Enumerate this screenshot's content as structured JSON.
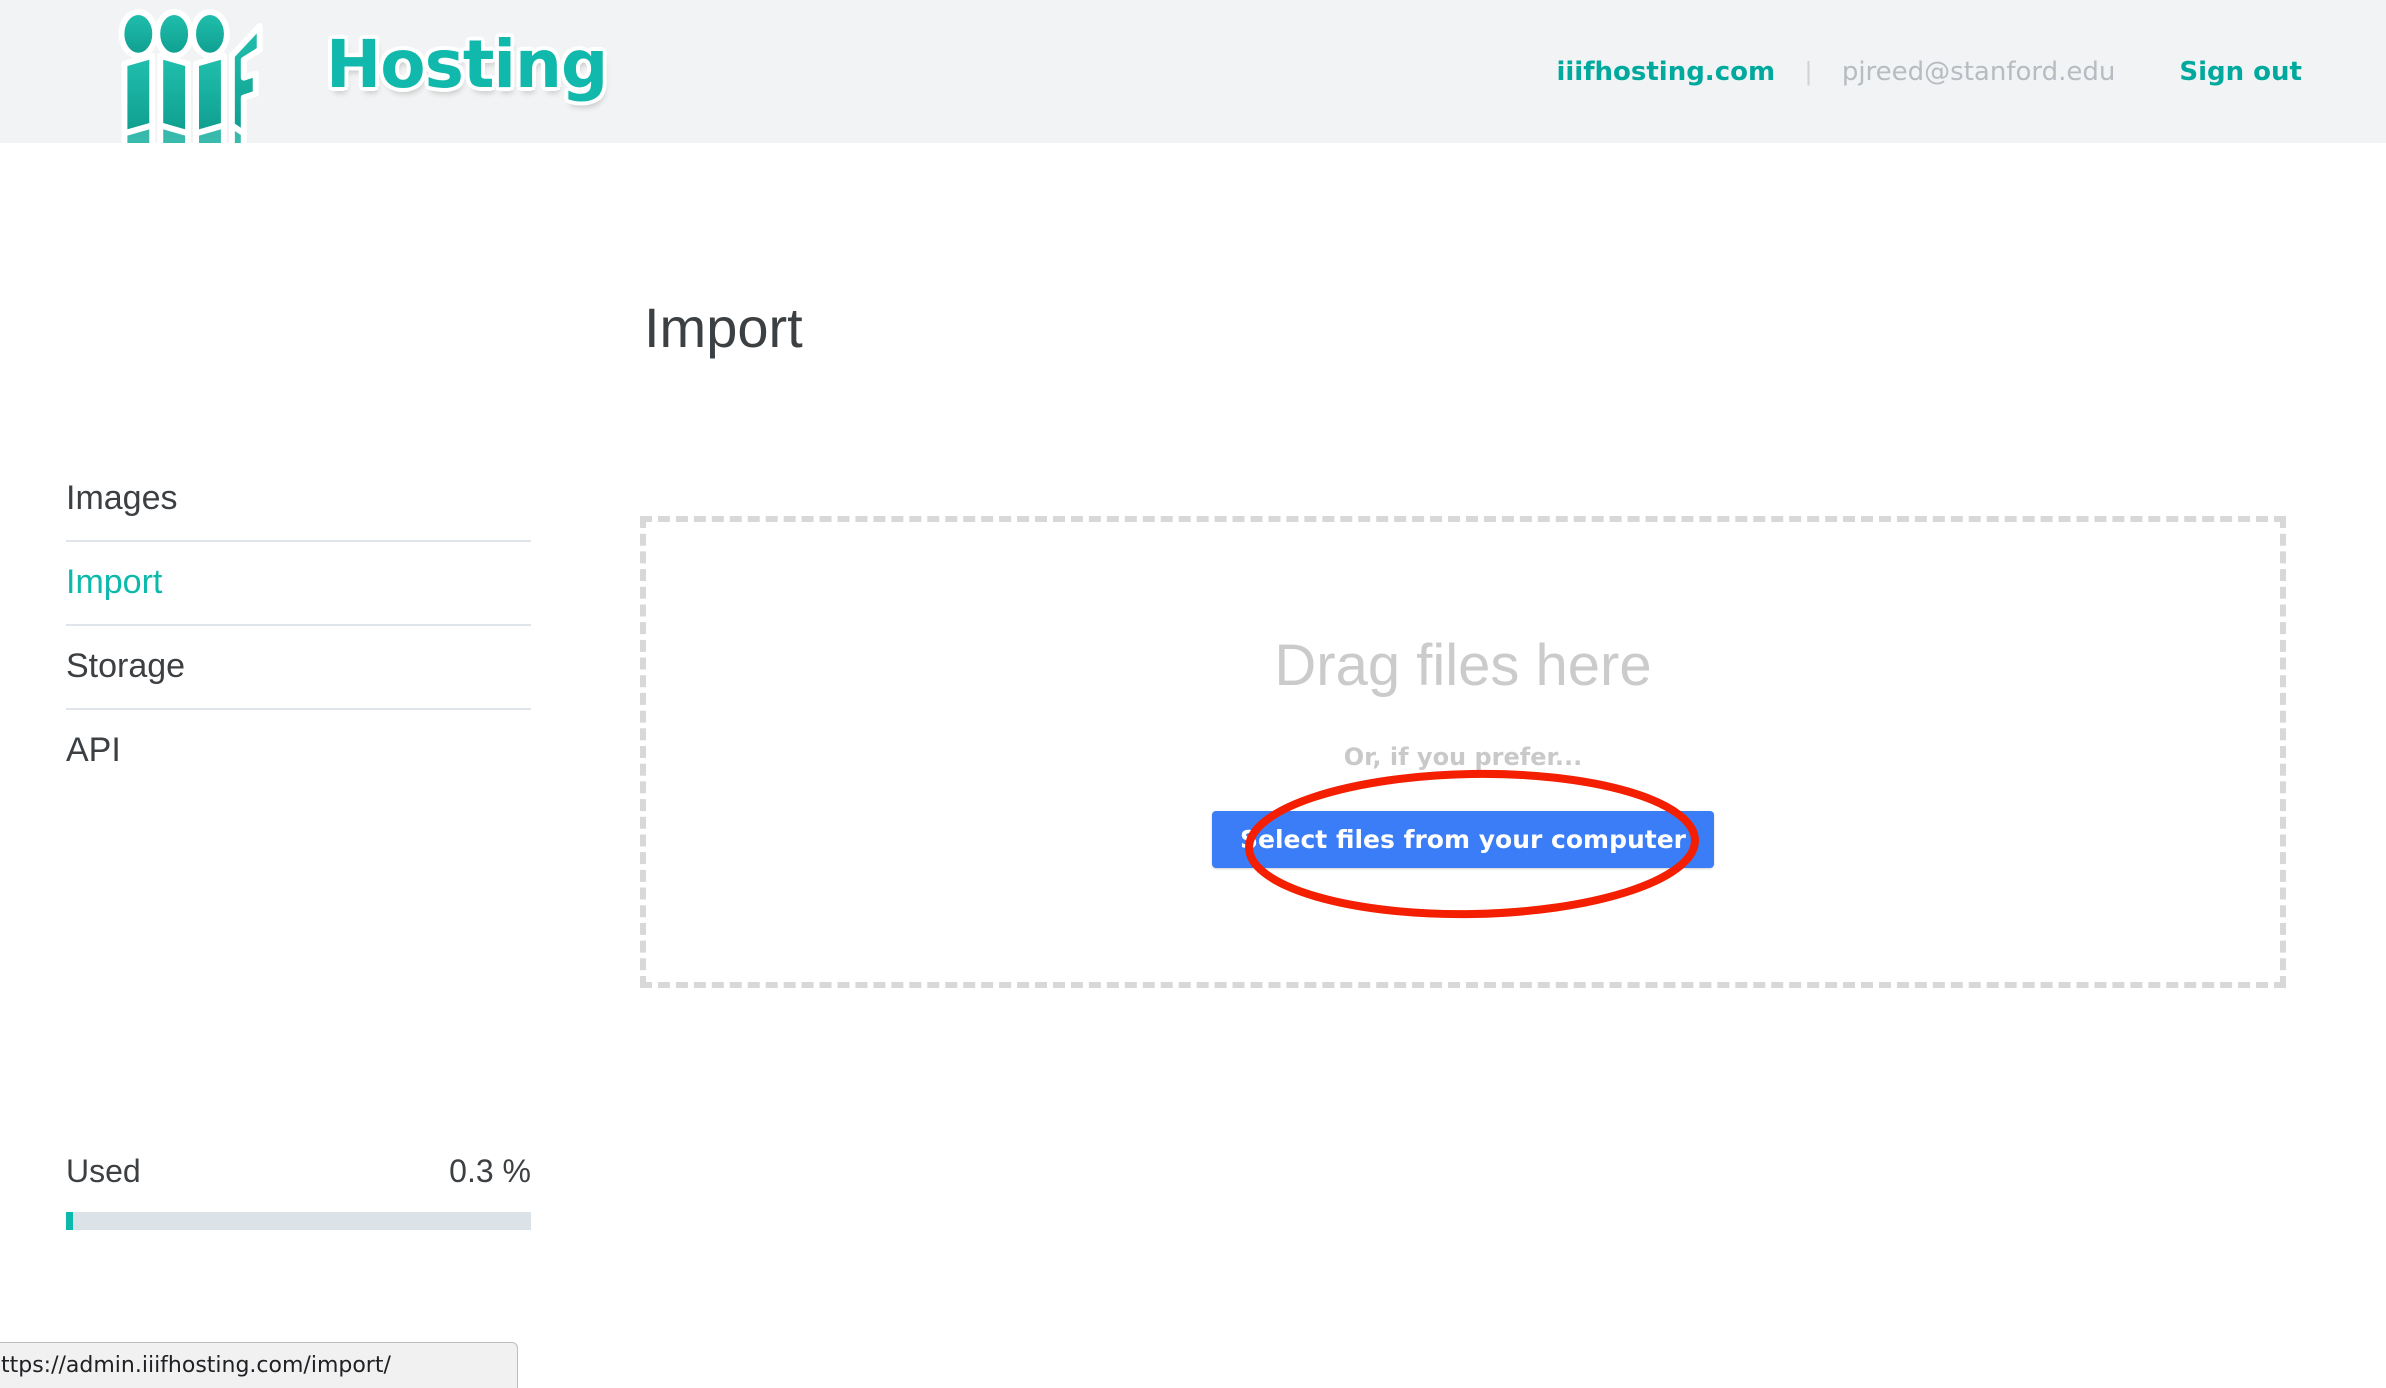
{
  "brand": {
    "logo_icon": "iiif-logo-icon",
    "word": "Hosting",
    "accent_color": "#10b9ab"
  },
  "header": {
    "site_link": "iiifhosting.com",
    "separator": "|",
    "user_email": "pjreed@stanford.edu",
    "sign_out": "Sign out"
  },
  "sidebar": {
    "items": [
      {
        "label": "Images",
        "active": false
      },
      {
        "label": "Import",
        "active": true
      },
      {
        "label": "Storage",
        "active": false
      },
      {
        "label": "API",
        "active": false
      }
    ],
    "usage": {
      "label": "Used",
      "value": "0.3 %",
      "percent": 0.3,
      "fill_color": "#0cb9ab",
      "track_color": "#dbe2e8"
    }
  },
  "main": {
    "title": "Import",
    "dropzone": {
      "title": "Drag files here",
      "subtitle": "Or, if you prefer...",
      "button_label": "Select files from your computer",
      "button_color": "#3b7df6"
    }
  },
  "annotation": {
    "shape": "ellipse",
    "color": "#f41e00",
    "target": "Select files from your computer"
  },
  "status_bar": {
    "url": "ttps://admin.iiifhosting.com/import/"
  }
}
